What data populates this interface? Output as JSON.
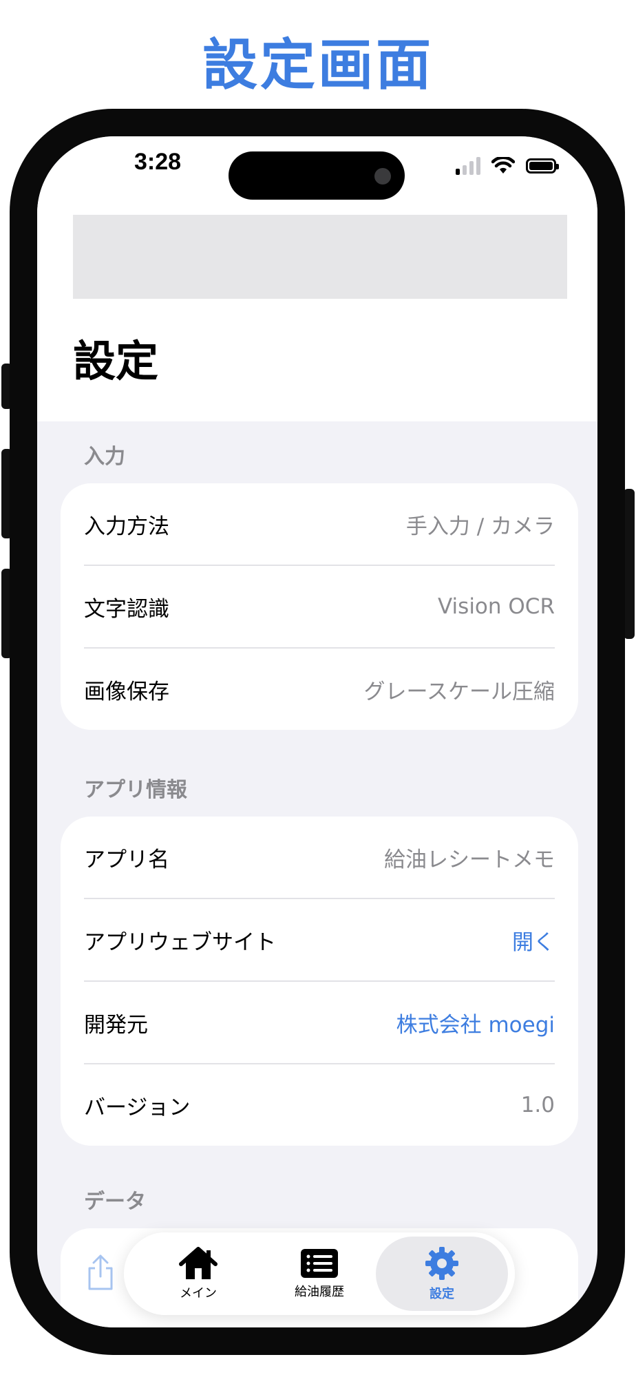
{
  "headline": "設定画面",
  "status_bar": {
    "time": "3:28"
  },
  "nav": {
    "title": "設定"
  },
  "sections": [
    {
      "header": "入力",
      "rows": [
        {
          "label": "入力方法",
          "value": "手入力 / カメラ"
        },
        {
          "label": "文字認識",
          "value": "Vision OCR"
        },
        {
          "label": "画像保存",
          "value": "グレースケール圧縮"
        }
      ]
    },
    {
      "header": "アプリ情報",
      "rows": [
        {
          "label": "アプリ名",
          "value": "給油レシートメモ"
        },
        {
          "label": "アプリウェブサイト",
          "value": "開く"
        },
        {
          "label": "開発元",
          "value": "株式会社 moegi"
        },
        {
          "label": "バージョン",
          "value": "1.0"
        }
      ]
    },
    {
      "header": "データ",
      "rows": []
    }
  ],
  "tabs": [
    {
      "label": "メイン",
      "icon": "house-icon"
    },
    {
      "label": "給油履歴",
      "icon": "list-icon"
    },
    {
      "label": "設定",
      "icon": "gear-icon",
      "active": true
    }
  ],
  "colors": {
    "accent": "#3d7de0",
    "secondary_text": "#8a8a8e",
    "grouped_background": "#f2f2f7"
  }
}
